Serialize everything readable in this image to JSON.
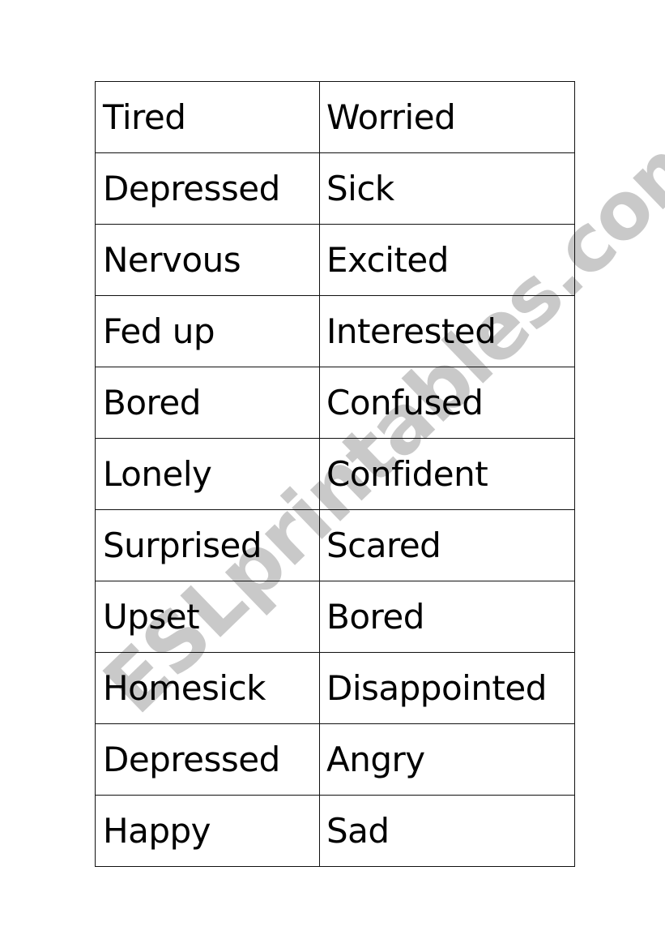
{
  "watermark": "ESLprintables.com",
  "table": {
    "rows": [
      [
        "Tired",
        "Worried"
      ],
      [
        "Depressed",
        "Sick"
      ],
      [
        "Nervous",
        "Excited"
      ],
      [
        "Fed up",
        "Interested"
      ],
      [
        "Bored",
        "Confused"
      ],
      [
        "Lonely",
        "Confident"
      ],
      [
        "Surprised",
        "Scared"
      ],
      [
        "Upset",
        "Bored"
      ],
      [
        "Homesick",
        "Disappointed"
      ],
      [
        "Depressed",
        "Angry"
      ],
      [
        "Happy",
        "Sad"
      ]
    ]
  }
}
